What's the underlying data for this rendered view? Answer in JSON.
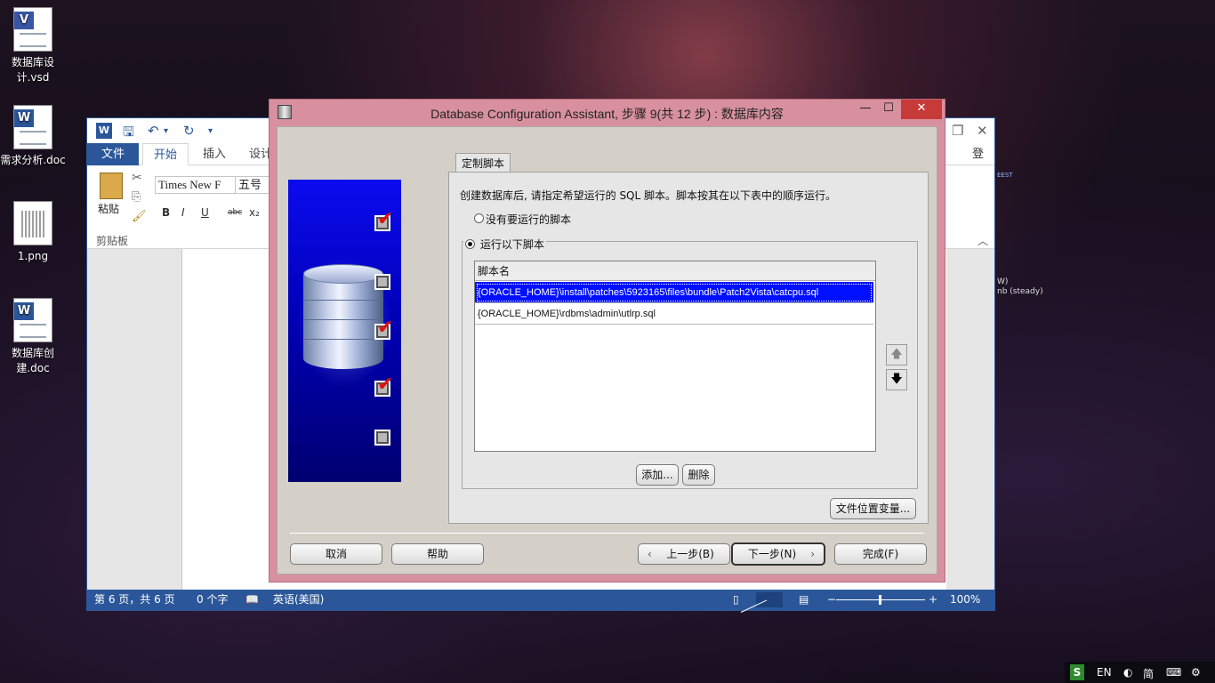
{
  "desktop": {
    "icons": [
      {
        "label": "数据库设计.vsd"
      },
      {
        "label": "需求分析.doc"
      },
      {
        "label": "1.png"
      },
      {
        "label": "数据库创建.doc"
      }
    ],
    "bg_text": {
      "eest": "EEST",
      "w": "W)",
      "steady": "nb (steady)"
    }
  },
  "word": {
    "logo": "W",
    "tabs": {
      "file": "文件",
      "home": "开始",
      "insert": "插入",
      "design": "设计"
    },
    "login": "登录",
    "clipboard": {
      "paste": "粘贴",
      "group": "剪贴板"
    },
    "font": {
      "name": "Times New F",
      "size": "五号"
    },
    "format_buttons": {
      "bold": "B",
      "italic": "I",
      "underline": "U",
      "strike": "abc",
      "sub": "x₂"
    },
    "status": {
      "page": "第 6 页，共 6 页",
      "words": "0 个字",
      "language": "英语(美国)",
      "zoom": "100%"
    }
  },
  "dialog": {
    "title": "Database Configuration Assistant, 步骤 9(共 12 步) : 数据库内容",
    "tab": "定制脚本",
    "description": "创建数据库后, 请指定希望运行的 SQL 脚本。脚本按其在以下表中的顺序运行。",
    "radio_none": "没有要运行的脚本",
    "radio_run": "运行以下脚本",
    "table_header": "脚本名",
    "scripts": [
      "{ORACLE_HOME}\\install\\patches\\5923165\\files\\bundle\\Patch2Vista\\catcpu.sql",
      "{ORACLE_HOME}\\rdbms\\admin\\utlrp.sql"
    ],
    "buttons": {
      "add": "添加...",
      "delete": "删除",
      "file_location": "文件位置变量...",
      "cancel": "取消",
      "help": "帮助",
      "back": "上一步(B)",
      "next": "下一步(N)",
      "finish": "完成(F)"
    },
    "side_checks": [
      true,
      false,
      true,
      true,
      false
    ]
  },
  "tray": {
    "app": "S",
    "lang": "EN",
    "ime": "简"
  }
}
